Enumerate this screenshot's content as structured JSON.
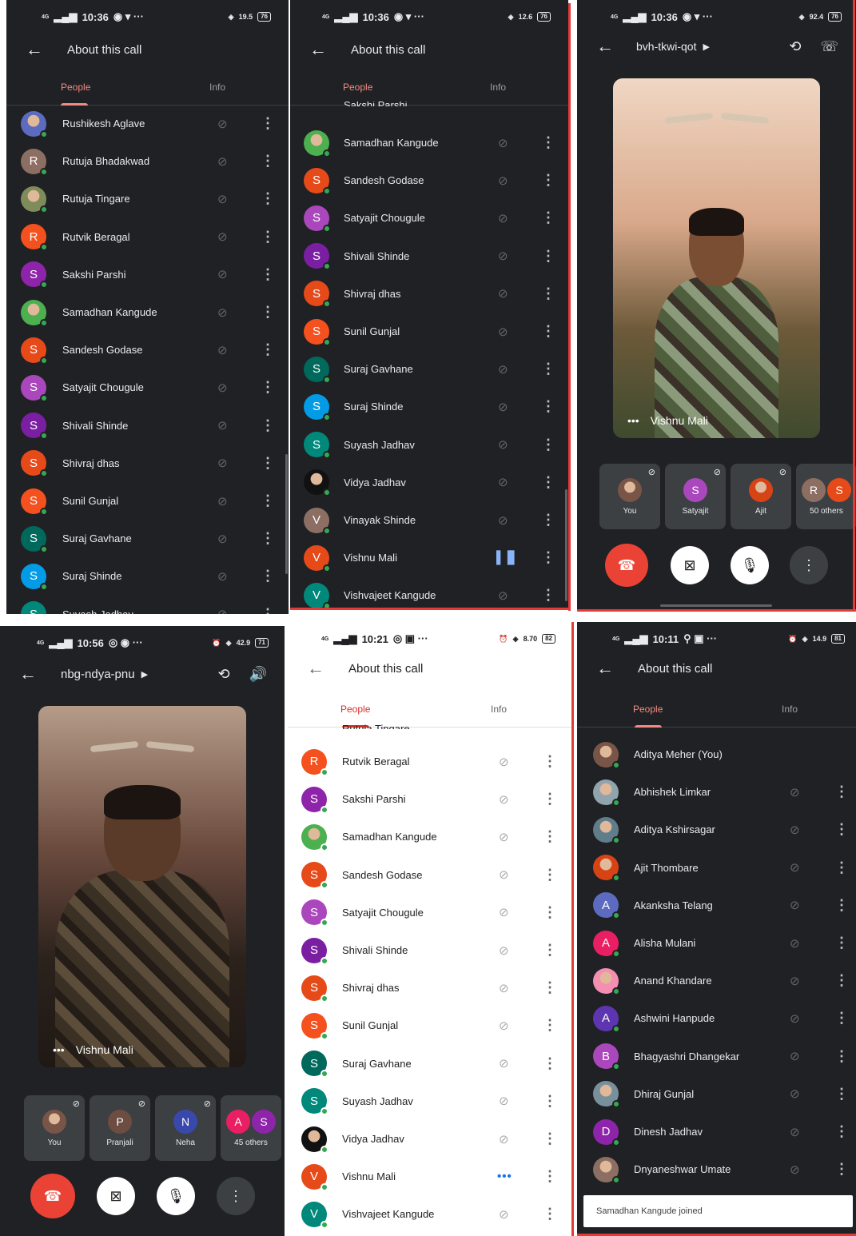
{
  "colors": {
    "dark_bg": "#202124",
    "accent": "#f28b82",
    "online": "#34a853",
    "end_call": "#ea4335",
    "speaking": "#8ab4f8"
  },
  "p1": {
    "status": {
      "net": "4G",
      "time": "10:36",
      "speed": "19.5",
      "battery": "76"
    },
    "title": "About this call",
    "tabs": {
      "people": "People",
      "info": "Info"
    },
    "rows": [
      {
        "name": "Rushikesh Aglave",
        "letter": "",
        "color": "#5c6bc0",
        "photo": true
      },
      {
        "name": "Rutuja Bhadakwad",
        "letter": "R",
        "color": "#8d6e63"
      },
      {
        "name": "Rutuja Tingare",
        "letter": "",
        "color": "#7e8c5a",
        "photo": true
      },
      {
        "name": "Rutvik Beragal",
        "letter": "R",
        "color": "#f4511e"
      },
      {
        "name": "Sakshi Parshi",
        "letter": "S",
        "color": "#8e24aa"
      },
      {
        "name": "Samadhan Kangude",
        "letter": "",
        "color": "#4caf50",
        "photo": true
      },
      {
        "name": "Sandesh Godase",
        "letter": "S",
        "color": "#e64a19"
      },
      {
        "name": "Satyajit Chougule",
        "letter": "S",
        "color": "#ab47bc"
      },
      {
        "name": "Shivali Shinde",
        "letter": "S",
        "color": "#7b1fa2"
      },
      {
        "name": "Shivraj dhas",
        "letter": "S",
        "color": "#e64a19"
      },
      {
        "name": "Sunil Gunjal",
        "letter": "S",
        "color": "#f4511e"
      },
      {
        "name": "Suraj Gavhane",
        "letter": "S",
        "color": "#00695c"
      },
      {
        "name": "Suraj Shinde",
        "letter": "S",
        "color": "#039be5"
      },
      {
        "name": "Suyash Jadhav",
        "letter": "S",
        "color": "#00897b"
      }
    ]
  },
  "p2": {
    "status": {
      "net": "4G",
      "time": "10:36",
      "speed": "12.6",
      "battery": "76"
    },
    "title": "About this call",
    "tabs": {
      "people": "People",
      "info": "Info"
    },
    "cut_name": "Sakshi Parshi",
    "rows": [
      {
        "name": "Samadhan Kangude",
        "letter": "",
        "color": "#4caf50",
        "photo": true,
        "state": "muted"
      },
      {
        "name": "Sandesh Godase",
        "letter": "S",
        "color": "#e64a19",
        "state": "muted"
      },
      {
        "name": "Satyajit Chougule",
        "letter": "S",
        "color": "#ab47bc",
        "state": "muted"
      },
      {
        "name": "Shivali Shinde",
        "letter": "S",
        "color": "#7b1fa2",
        "state": "muted"
      },
      {
        "name": "Shivraj dhas",
        "letter": "S",
        "color": "#e64a19",
        "state": "muted"
      },
      {
        "name": "Sunil Gunjal",
        "letter": "S",
        "color": "#f4511e",
        "state": "muted"
      },
      {
        "name": "Suraj Gavhane",
        "letter": "S",
        "color": "#00695c",
        "state": "muted"
      },
      {
        "name": "Suraj Shinde",
        "letter": "S",
        "color": "#039be5",
        "state": "muted"
      },
      {
        "name": "Suyash Jadhav",
        "letter": "S",
        "color": "#00897b",
        "state": "muted"
      },
      {
        "name": "Vidya Jadhav",
        "letter": "",
        "color": "#111111",
        "photo": true,
        "state": "muted"
      },
      {
        "name": "Vinayak Shinde",
        "letter": "V",
        "color": "#8d6e63",
        "state": "muted"
      },
      {
        "name": "Vishnu Mali",
        "letter": "V",
        "color": "#e64a19",
        "state": "speaking"
      },
      {
        "name": "Vishvajeet Kangude",
        "letter": "V",
        "color": "#00897b",
        "state": "muted"
      }
    ]
  },
  "p3": {
    "status": {
      "net": "4G",
      "time": "10:36",
      "speed": "92.4",
      "battery": "76"
    },
    "meeting_code": "bvh-tkwi-qot",
    "speaker": "Vishnu Mali",
    "tiles": [
      {
        "label": "You",
        "letter": "",
        "color": "#795548",
        "photo": true
      },
      {
        "label": "Satyajit",
        "letter": "S",
        "color": "#ab47bc"
      },
      {
        "label": "Ajit",
        "letter": "",
        "color": "#d84315",
        "photo": true
      },
      {
        "label": "50 others",
        "letters": [
          "R",
          "S"
        ],
        "colors": [
          "#8d6e63",
          "#e64a19"
        ]
      }
    ]
  },
  "p4": {
    "status": {
      "net": "4G",
      "time": "10:56",
      "speed": "42.9",
      "battery": "71"
    },
    "meeting_code": "nbg-ndya-pnu",
    "speaker": "Vishnu Mali",
    "tiles": [
      {
        "label": "You",
        "letter": "",
        "color": "#795548",
        "photo": true
      },
      {
        "label": "Pranjali",
        "letter": "P",
        "color": "#6d4c41"
      },
      {
        "label": "Neha",
        "letter": "N",
        "color": "#3949ab"
      },
      {
        "label": "45 others",
        "letters": [
          "A",
          "S"
        ],
        "colors": [
          "#e91e63",
          "#8e24aa"
        ]
      }
    ]
  },
  "p5": {
    "status": {
      "net": "4G",
      "time": "10:21",
      "speed": "8.70",
      "battery": "82"
    },
    "title": "About this call",
    "tabs": {
      "people": "People",
      "info": "Info"
    },
    "cut_name": "Rutuja Tingare",
    "rows": [
      {
        "name": "Rutvik Beragal",
        "letter": "R",
        "color": "#f4511e",
        "state": "muted"
      },
      {
        "name": "Sakshi Parshi",
        "letter": "S",
        "color": "#8e24aa",
        "state": "muted"
      },
      {
        "name": "Samadhan Kangude",
        "letter": "",
        "color": "#4caf50",
        "photo": true,
        "state": "muted"
      },
      {
        "name": "Sandesh Godase",
        "letter": "S",
        "color": "#e64a19",
        "state": "muted"
      },
      {
        "name": "Satyajit Chougule",
        "letter": "S",
        "color": "#ab47bc",
        "state": "muted"
      },
      {
        "name": "Shivali Shinde",
        "letter": "S",
        "color": "#7b1fa2",
        "state": "muted"
      },
      {
        "name": "Shivraj dhas",
        "letter": "S",
        "color": "#e64a19",
        "state": "muted"
      },
      {
        "name": "Sunil Gunjal",
        "letter": "S",
        "color": "#f4511e",
        "state": "muted"
      },
      {
        "name": "Suraj Gavhane",
        "letter": "S",
        "color": "#00695c",
        "state": "muted"
      },
      {
        "name": "Suyash Jadhav",
        "letter": "S",
        "color": "#00897b",
        "state": "muted"
      },
      {
        "name": "Vidya Jadhav",
        "letter": "",
        "color": "#111111",
        "photo": true,
        "state": "muted"
      },
      {
        "name": "Vishnu Mali",
        "letter": "V",
        "color": "#e64a19",
        "state": "speaking"
      },
      {
        "name": "Vishvajeet Kangude",
        "letter": "V",
        "color": "#00897b",
        "state": "muted"
      }
    ]
  },
  "p6": {
    "status": {
      "net": "4G",
      "time": "10:11",
      "speed": "14.9",
      "battery": "81"
    },
    "title": "About this call",
    "tabs": {
      "people": "People",
      "info": "Info"
    },
    "rows": [
      {
        "name": "Aditya Meher (You)",
        "letter": "",
        "color": "#795548",
        "photo": true,
        "state": "none"
      },
      {
        "name": "Abhishek Limkar",
        "letter": "",
        "color": "#90a4ae",
        "photo": true,
        "state": "muted"
      },
      {
        "name": "Aditya Kshirsagar",
        "letter": "",
        "color": "#607d8b",
        "photo": true,
        "state": "muted"
      },
      {
        "name": "Ajit Thombare",
        "letter": "",
        "color": "#d84315",
        "photo": true,
        "state": "muted"
      },
      {
        "name": "Akanksha Telang",
        "letter": "A",
        "color": "#5c6bc0",
        "state": "muted"
      },
      {
        "name": "Alisha Mulani",
        "letter": "A",
        "color": "#e91e63",
        "state": "muted"
      },
      {
        "name": "Anand Khandare",
        "letter": "",
        "color": "#f48fb1",
        "photo": true,
        "state": "muted"
      },
      {
        "name": "Ashwini Hanpude",
        "letter": "A",
        "color": "#5e35b1",
        "state": "muted"
      },
      {
        "name": "Bhagyashri Dhangekar",
        "letter": "B",
        "color": "#ab47bc",
        "state": "muted"
      },
      {
        "name": "Dhiraj Gunjal",
        "letter": "",
        "color": "#78909c",
        "photo": true,
        "state": "muted"
      },
      {
        "name": "Dinesh Jadhav",
        "letter": "D",
        "color": "#8e24aa",
        "state": "muted"
      },
      {
        "name": "Dnyaneshwar Umate",
        "letter": "",
        "color": "#8d6e63",
        "photo": true,
        "state": "muted"
      }
    ],
    "toast": "Samadhan Kangude joined"
  }
}
